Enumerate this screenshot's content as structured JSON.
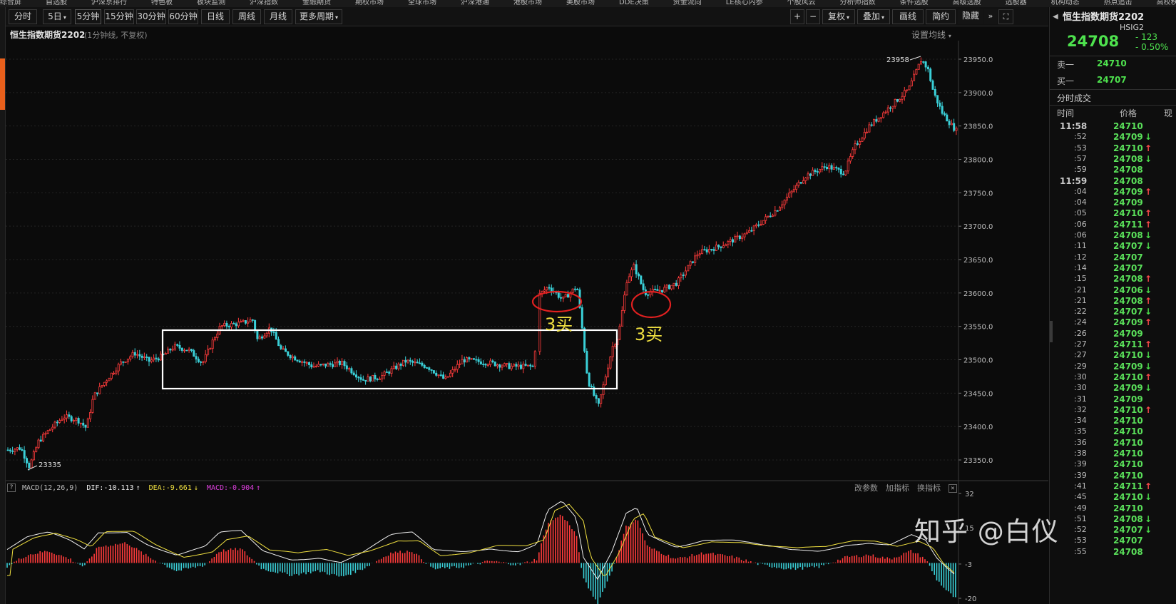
{
  "topnav": [
    "综合屏",
    "自选股",
    "沪深京排行",
    "特色板",
    "板块监测",
    "沪深指数",
    "金融期货",
    "期权市场",
    "全球市场",
    "沪深港通",
    "港股市场",
    "美股市场",
    "DDE决策",
    "资金流向",
    "LE核心内参",
    "个股风云",
    "分析师指数",
    "条件选股",
    "高级选股",
    "选股器",
    "机构动态",
    "热点追击",
    "高校秩序"
  ],
  "toolbar": {
    "periods": [
      "分时",
      "5日",
      "5分钟",
      "15分钟",
      "30分钟",
      "60分钟",
      "日线",
      "周线",
      "月线",
      "更多周期"
    ],
    "right_buttons": [
      "+",
      "−",
      "复权",
      "叠加",
      "画线",
      "简约",
      "隐藏"
    ],
    "expand_icon": "expand-icon"
  },
  "chart": {
    "title": "恒生指数期货2202",
    "subtitle": "(1分钟线, 不复权)",
    "settings": "设置均线",
    "high_label": "23958",
    "low_label": "23335",
    "yticks": [
      "23950.0",
      "23900.0",
      "23850.0",
      "23800.0",
      "23750.0",
      "23700.0",
      "23650.0",
      "23600.0",
      "23550.0",
      "23500.0",
      "23450.0",
      "23400.0",
      "23350.0"
    ],
    "annotations": [
      "3买",
      "3买"
    ],
    "colors": {
      "up": "#ff3b3b",
      "down": "#3ad0d8",
      "box": "#ffffff",
      "circle": "#e02020",
      "annot": "#f0e040"
    }
  },
  "macd": {
    "help": "?",
    "name": "MACD(12,26,9)",
    "dif": "DIF:-10.113",
    "dea": "DEA:-9.661",
    "macd": "MACD:-0.904",
    "actions": [
      "改参数",
      "加指标",
      "换指标"
    ],
    "close": "✕",
    "yticks": [
      "32",
      "15",
      "-3",
      "-20"
    ]
  },
  "quote": {
    "name": "恒生指数期货2202",
    "code": "HSIG2",
    "price": "24708",
    "change": "- 123",
    "pct": "- 0.50%",
    "sell_label": "卖一",
    "sell_price": "24710",
    "buy_label": "买一",
    "buy_price": "24707",
    "ticks_title": "分时成交",
    "col_time": "时间",
    "col_price": "价格",
    "col_vol": "现",
    "ticks": [
      {
        "t": "11:58",
        "p": "24710",
        "d": ""
      },
      {
        "t": ":52",
        "p": "24709",
        "d": "dn"
      },
      {
        "t": ":53",
        "p": "24710",
        "d": "up"
      },
      {
        "t": ":57",
        "p": "24708",
        "d": "dn"
      },
      {
        "t": ":59",
        "p": "24708",
        "d": ""
      },
      {
        "t": "11:59",
        "p": "24708",
        "d": ""
      },
      {
        "t": ":04",
        "p": "24709",
        "d": "up"
      },
      {
        "t": ":04",
        "p": "24709",
        "d": ""
      },
      {
        "t": ":05",
        "p": "24710",
        "d": "up"
      },
      {
        "t": ":06",
        "p": "24711",
        "d": "up"
      },
      {
        "t": ":06",
        "p": "24708",
        "d": "dn"
      },
      {
        "t": ":11",
        "p": "24707",
        "d": "dn"
      },
      {
        "t": ":12",
        "p": "24707",
        "d": ""
      },
      {
        "t": ":14",
        "p": "24707",
        "d": ""
      },
      {
        "t": ":15",
        "p": "24708",
        "d": "up"
      },
      {
        "t": ":21",
        "p": "24706",
        "d": "dn"
      },
      {
        "t": ":21",
        "p": "24708",
        "d": "up"
      },
      {
        "t": ":22",
        "p": "24707",
        "d": "dn"
      },
      {
        "t": ":24",
        "p": "24709",
        "d": "up"
      },
      {
        "t": ":26",
        "p": "24709",
        "d": ""
      },
      {
        "t": ":27",
        "p": "24711",
        "d": "up"
      },
      {
        "t": ":27",
        "p": "24710",
        "d": "dn"
      },
      {
        "t": ":29",
        "p": "24709",
        "d": "dn"
      },
      {
        "t": ":30",
        "p": "24710",
        "d": "up"
      },
      {
        "t": ":30",
        "p": "24709",
        "d": "dn"
      },
      {
        "t": ":31",
        "p": "24709",
        "d": ""
      },
      {
        "t": ":32",
        "p": "24710",
        "d": "up"
      },
      {
        "t": ":34",
        "p": "24710",
        "d": ""
      },
      {
        "t": ":35",
        "p": "24710",
        "d": ""
      },
      {
        "t": ":36",
        "p": "24710",
        "d": ""
      },
      {
        "t": ":38",
        "p": "24710",
        "d": ""
      },
      {
        "t": ":39",
        "p": "24710",
        "d": ""
      },
      {
        "t": ":39",
        "p": "24710",
        "d": ""
      },
      {
        "t": ":41",
        "p": "24711",
        "d": "up"
      },
      {
        "t": ":45",
        "p": "24710",
        "d": "dn"
      },
      {
        "t": ":49",
        "p": "24710",
        "d": ""
      },
      {
        "t": ":51",
        "p": "24708",
        "d": "dn"
      },
      {
        "t": ":52",
        "p": "24707",
        "d": "dn"
      },
      {
        "t": ":53",
        "p": "24707",
        "d": ""
      },
      {
        "t": ":55",
        "p": "24708",
        "d": ""
      }
    ]
  },
  "watermark": "知乎 @白仪"
}
